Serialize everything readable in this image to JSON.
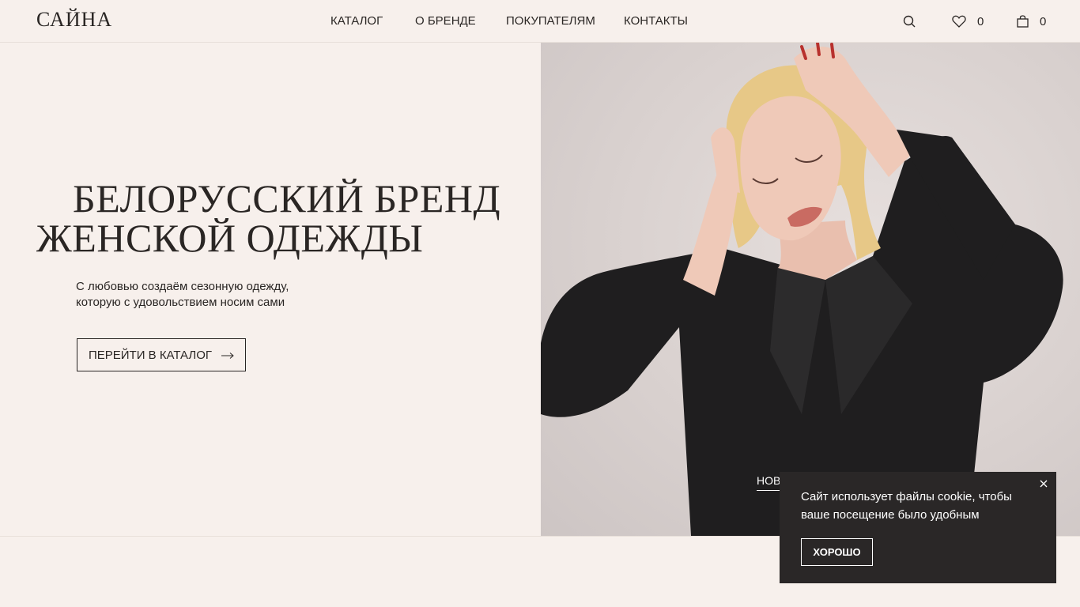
{
  "header": {
    "logo": "САЙНА",
    "nav": [
      {
        "label": "КАТАЛОГ"
      },
      {
        "label": "О БРЕНДЕ"
      },
      {
        "label": "ПОКУПАТЕЛЯМ"
      },
      {
        "label": "КОНТАКТЫ"
      }
    ],
    "favorites_count": "0",
    "cart_count": "0",
    "icons": {
      "search": "search-icon",
      "favorites": "heart-icon",
      "cart": "shopping-bag-icon"
    }
  },
  "hero": {
    "title_line1": "БЕЛОРУССКИЙ БРЕНД",
    "title_line2": "ЖЕНСКОЙ ОДЕЖДЫ",
    "subtitle_line1": "С любовью создаём сезонную одежду,",
    "subtitle_line2": "которую с удовольствием носим сами",
    "cta_label": "ПЕРЕЙТИ В КАТАЛОГ",
    "image_link_label": "НОВ",
    "image_alt": "woman in black blazer"
  },
  "cookie_banner": {
    "text": "Сайт использует файлы cookie, чтобы ваше посещение было удобным",
    "ok_label": "ХОРОШО"
  },
  "colors": {
    "background": "#f7f0ec",
    "text": "#2a2624",
    "banner": "#2a2727"
  }
}
